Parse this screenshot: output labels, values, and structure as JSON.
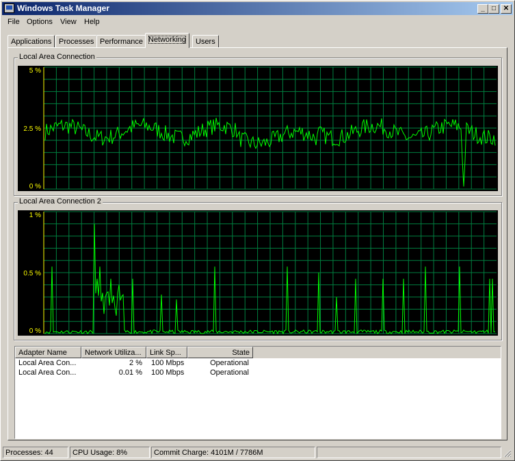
{
  "window": {
    "title": "Windows Task Manager"
  },
  "title_buttons": {
    "minimize": "_",
    "maximize": "□",
    "close": "✕"
  },
  "menu": [
    "File",
    "Options",
    "View",
    "Help"
  ],
  "tabs": [
    {
      "label": "Applications",
      "active": false
    },
    {
      "label": "Processes",
      "active": false
    },
    {
      "label": "Performance",
      "active": false
    },
    {
      "label": "Networking",
      "active": true
    },
    {
      "label": "Users",
      "active": false
    }
  ],
  "graphs": [
    {
      "title": "Local Area Connection",
      "y_labels": [
        "5 %",
        "2.5 %",
        "0 %"
      ],
      "max": 5,
      "color": "#00ff00",
      "grid_color": "#008040",
      "chart_data": {
        "type": "line",
        "ylim": [
          0,
          5
        ],
        "values_hint": "fluctuating around 2.0-2.7%, one dip near 0% near the right end"
      }
    },
    {
      "title": "Local Area Connection 2",
      "y_labels": [
        "1 %",
        "0.5 %",
        "0 %"
      ],
      "max": 1,
      "color": "#00ff00",
      "grid_color": "#008040",
      "chart_data": {
        "type": "line",
        "ylim": [
          0,
          1
        ],
        "values_hint": "near 0% with periodic spikes up to ~0.55%, one spike near 0.9%"
      }
    }
  ],
  "adapters": {
    "columns": [
      "Adapter Name",
      "Network Utiliza...",
      "Link Sp...",
      "State"
    ],
    "rows": [
      {
        "name": "Local Area Con...",
        "util": "2 %",
        "speed": "100 Mbps",
        "state": "Operational"
      },
      {
        "name": "Local Area Con...",
        "util": "0.01 %",
        "speed": "100 Mbps",
        "state": "Operational"
      }
    ]
  },
  "status": {
    "processes": "Processes: 44",
    "cpu": "CPU Usage: 8%",
    "commit": "Commit Charge: 4101M / 7786M"
  }
}
